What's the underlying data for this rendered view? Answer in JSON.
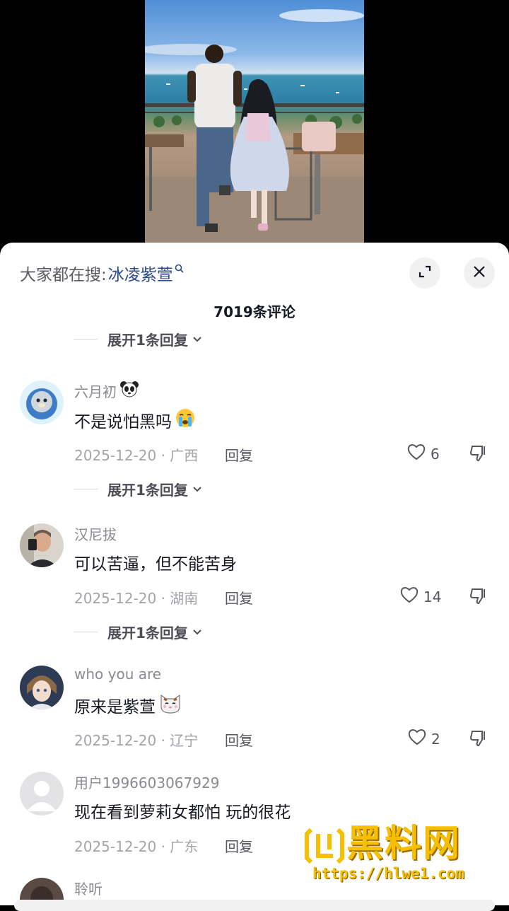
{
  "search": {
    "prefix": "大家都在搜:",
    "term": "冰凌紫萱"
  },
  "comments_title": "7019条评论",
  "expand_label": "展开1条回复",
  "reply_label": "回复",
  "comments": [
    {
      "username": "六月初",
      "username_emoji": "panda-emoji",
      "text": "不是说怕黑吗",
      "text_emoji": "crying-face-emoji",
      "meta": "2025-12-20 · 广西",
      "likes": "6",
      "has_expand": true
    },
    {
      "username": "汉尼拔",
      "text": "可以苦逼，但不能苦身",
      "meta": "2025-12-20 · 湖南",
      "likes": "14",
      "has_expand": true
    },
    {
      "username": "who you are",
      "text": "原来是紫萱",
      "text_emoji": "cat-face-emoji",
      "meta": "2025-12-20 · 辽宁",
      "likes": "2",
      "has_expand": false
    },
    {
      "username": "用户1996603067929",
      "text": "现在看到萝莉女都怕  玩的很花",
      "meta": "2025-12-20 · 广东",
      "has_expand": false
    },
    {
      "username": "聆听"
    }
  ],
  "watermark": {
    "title": "黑料网",
    "url": "https://hlwe1.com"
  },
  "colors": {
    "accent_link": "#2a4a8a",
    "watermark": "#f6c000",
    "text_primary": "#161823",
    "text_secondary": "#8a8b91"
  }
}
